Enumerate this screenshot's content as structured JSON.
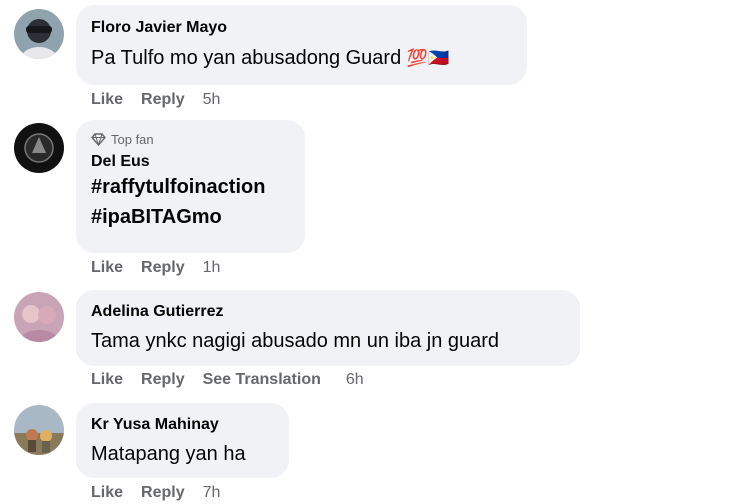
{
  "comments": [
    {
      "name": "Floro Javier Mayo",
      "lines": [
        "Pa Tulfo mo yan abusadong Guard"
      ],
      "emoji": [
        "💯",
        "🇵🇭"
      ],
      "like": "Like",
      "reply": "Reply",
      "time": "5h"
    },
    {
      "badge": "Top fan",
      "name": "Del Eus",
      "lines": [
        "#raffytulfoinaction",
        "#ipaBITAGmo"
      ],
      "like": "Like",
      "reply": "Reply",
      "time": "1h"
    },
    {
      "name": "Adelina Gutierrez",
      "lines": [
        "Tama ynkc nagigi abusado mn un iba jn guard"
      ],
      "like": "Like",
      "reply": "Reply",
      "see_translation": "See Translation",
      "time": "6h"
    },
    {
      "name": "Kr Yusa Mahinay",
      "lines": [
        "Matapang yan ha"
      ],
      "like": "Like",
      "reply": "Reply",
      "time": "7h"
    }
  ],
  "colors": {
    "bubble": "#f0f2f5",
    "name": "#050505",
    "meta": "#65676b"
  }
}
